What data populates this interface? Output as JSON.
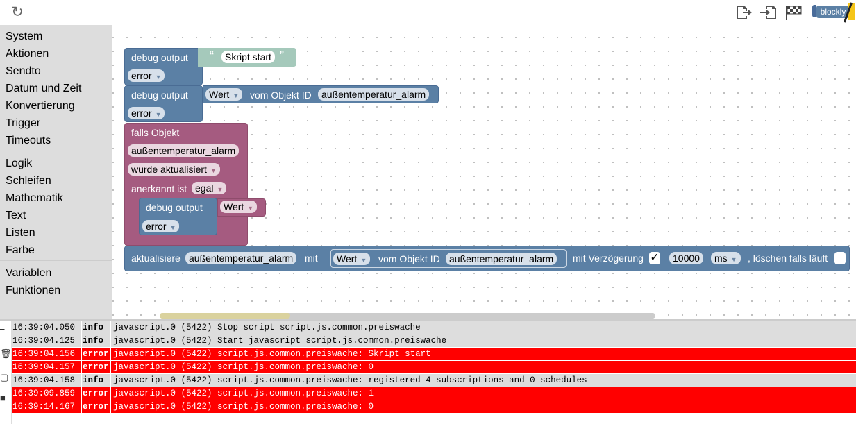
{
  "toolbar": {
    "refresh_icon": "refresh-icon",
    "blockly_label": "blockly"
  },
  "sidebar": {
    "items": [
      "System",
      "Aktionen",
      "Sendto",
      "Datum und Zeit",
      "Konvertierung",
      "Trigger",
      "Timeouts",
      "Logik",
      "Schleifen",
      "Mathematik",
      "Text",
      "Listen",
      "Farbe",
      "Variablen",
      "Funktionen"
    ]
  },
  "blocks": {
    "b1_label": "debug output",
    "b1_text": "Skript start",
    "b1_level": "error",
    "b2_label": "debug output",
    "b2_value": "Wert",
    "b2_mid": "vom Objekt ID",
    "b2_obj": "außentemperatur_alarm",
    "b2_level": "error",
    "b3_label": "falls Objekt",
    "b3_obj": "außentemperatur_alarm",
    "b3_event": "wurde aktualisiert",
    "b3_ack_label": "anerkannt ist",
    "b3_ack": "egal",
    "b4_label": "debug output",
    "b4_value": "Wert",
    "b4_level": "error",
    "b5_label": "aktualisiere",
    "b5_obj": "außentemperatur_alarm",
    "b5_mit": "mit",
    "b5_value": "Wert",
    "b5_mid": "vom Objekt ID",
    "b5_obj2": "außentemperatur_alarm",
    "b5_delay_label": "mit Verzögerung",
    "b5_delay_check": "✓",
    "b5_delay": "10000",
    "b5_unit": "ms",
    "b5_clear_label": ", löschen falls läuft"
  },
  "log": {
    "rows": [
      {
        "time": "16:39:04.050",
        "severity": "info",
        "message": "javascript.0 (5422) Stop script script.js.common.preiswache"
      },
      {
        "time": "16:39:04.125",
        "severity": "info",
        "message": "javascript.0 (5422) Start javascript script.js.common.preiswache"
      },
      {
        "time": "16:39:04.156",
        "severity": "error",
        "message": "javascript.0 (5422) script.js.common.preiswache: Skript start"
      },
      {
        "time": "16:39:04.157",
        "severity": "error",
        "message": "javascript.0 (5422) script.js.common.preiswache: 0"
      },
      {
        "time": "16:39:04.158",
        "severity": "info",
        "message": "javascript.0 (5422) script.js.common.preiswache: registered 4 subscriptions and 0 schedules"
      },
      {
        "time": "16:39:09.859",
        "severity": "error",
        "message": "javascript.0 (5422) script.js.common.preiswache: 1"
      },
      {
        "time": "16:39:14.167",
        "severity": "error",
        "message": "javascript.0 (5422) script.js.common.preiswache: 0"
      }
    ]
  },
  "colors": {
    "logic_block": "#a55b80",
    "action_block": "#5b80a5",
    "text_block": "#a5c9bb",
    "error_row": "#ff0000",
    "info_row": "#dddddd"
  }
}
